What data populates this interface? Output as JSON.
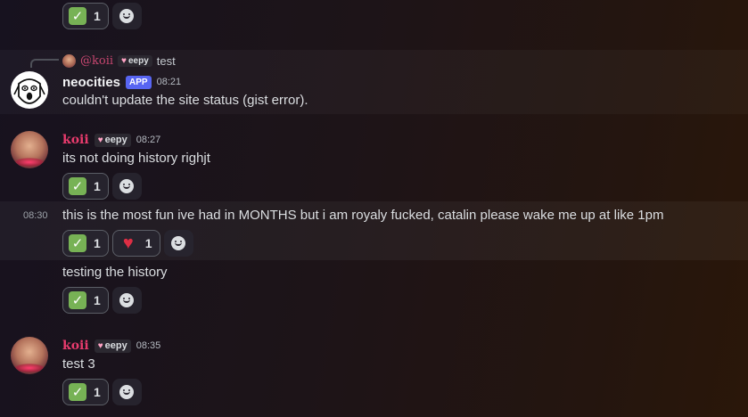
{
  "top_reactions": [
    {
      "emoji": "check-emoji",
      "count": "1"
    }
  ],
  "reply": {
    "mention": "@koii",
    "tag": "eepy",
    "text": "test"
  },
  "messages": {
    "neocities": {
      "username": "neocities",
      "badge": "APP",
      "time": "08:21",
      "text": "couldn't update the site status (gist error)."
    },
    "koii1": {
      "username": "koii",
      "tag": "eepy",
      "time": "08:27",
      "text": "its not doing history righjt",
      "reactions": [
        {
          "emoji": "check-emoji",
          "count": "1"
        }
      ]
    },
    "followup1": {
      "time": "08:30",
      "text": "this is the most fun ive had in MONTHS but i am royaly fucked, catalin please wake me up at like 1pm",
      "reactions": [
        {
          "emoji": "check-emoji",
          "count": "1"
        },
        {
          "emoji": "heart-emoji",
          "count": "1"
        }
      ]
    },
    "followup2": {
      "text": "testing the history",
      "reactions": [
        {
          "emoji": "check-emoji",
          "count": "1"
        }
      ]
    },
    "koii2": {
      "username": "koii",
      "tag": "eepy",
      "time": "08:35",
      "text": "test 3",
      "reactions": [
        {
          "emoji": "check-emoji",
          "count": "1"
        }
      ]
    }
  },
  "colors": {
    "accent": "#5865f2",
    "koii_name": "#e83b6d",
    "check": "#77b255",
    "heart": "#dd2e44"
  }
}
